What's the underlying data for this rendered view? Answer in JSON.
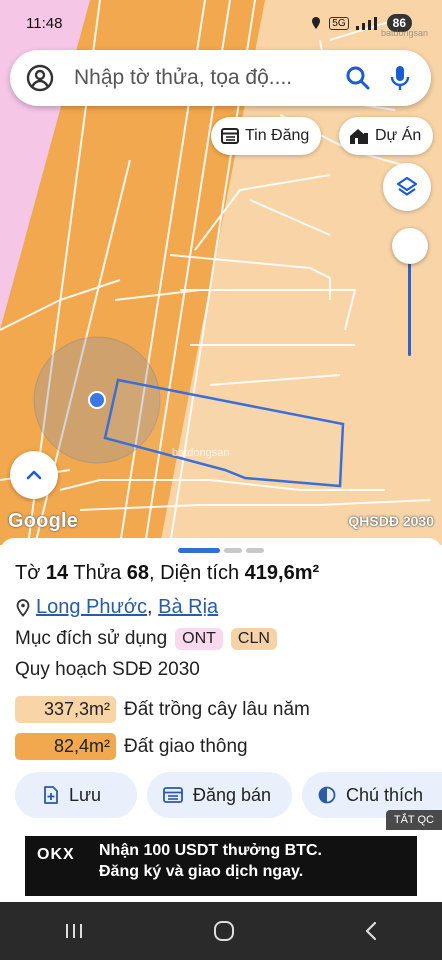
{
  "status_bar": {
    "time": "11:48",
    "network": "5G",
    "battery": "86",
    "watermark": "batdongsan"
  },
  "search": {
    "placeholder": "Nhập tờ thửa, tọa độ...."
  },
  "chips": {
    "listings": "Tin Đăng",
    "projects": "Dự Án"
  },
  "map": {
    "brand": "Google",
    "plan_label": "QHSDĐ 2030",
    "watermark": "batdongsan"
  },
  "parcel": {
    "sheet_label": "Tờ",
    "sheet_no": "14",
    "plot_label": "Thửa",
    "plot_no": "68",
    "area_label": ", Diện tích",
    "area": "419,6m²",
    "location_a": "Long Phước",
    "location_sep": ", ",
    "location_b": "Bà Rịa",
    "purpose_label": "Mục đích sử dụng",
    "purpose_tags": [
      "ONT",
      "CLN"
    ],
    "plan_title": "Quy hoạch SDĐ 2030",
    "zones": [
      {
        "area": "337,3m²",
        "label": "Đất trồng cây lâu năm",
        "color": "#f8d4a6"
      },
      {
        "area": "82,4m²",
        "label": "Đất giao thông",
        "color": "#f2a84e"
      }
    ]
  },
  "actions": {
    "save": "Lưu",
    "post": "Đăng bán",
    "legend": "Chú thích"
  },
  "ad": {
    "badge": "TẮT QC",
    "brand": "OKX",
    "line1": "Nhận 100 USDT thưởng BTC.",
    "line2": "Đăng ký và giao dịch ngay."
  },
  "colors": {
    "accent": "#2f6fd6",
    "road": "#f2a84e",
    "perennial": "#f8d4a6",
    "residential": "#f8d9ee",
    "parcel_outline": "#3a6fd8"
  }
}
